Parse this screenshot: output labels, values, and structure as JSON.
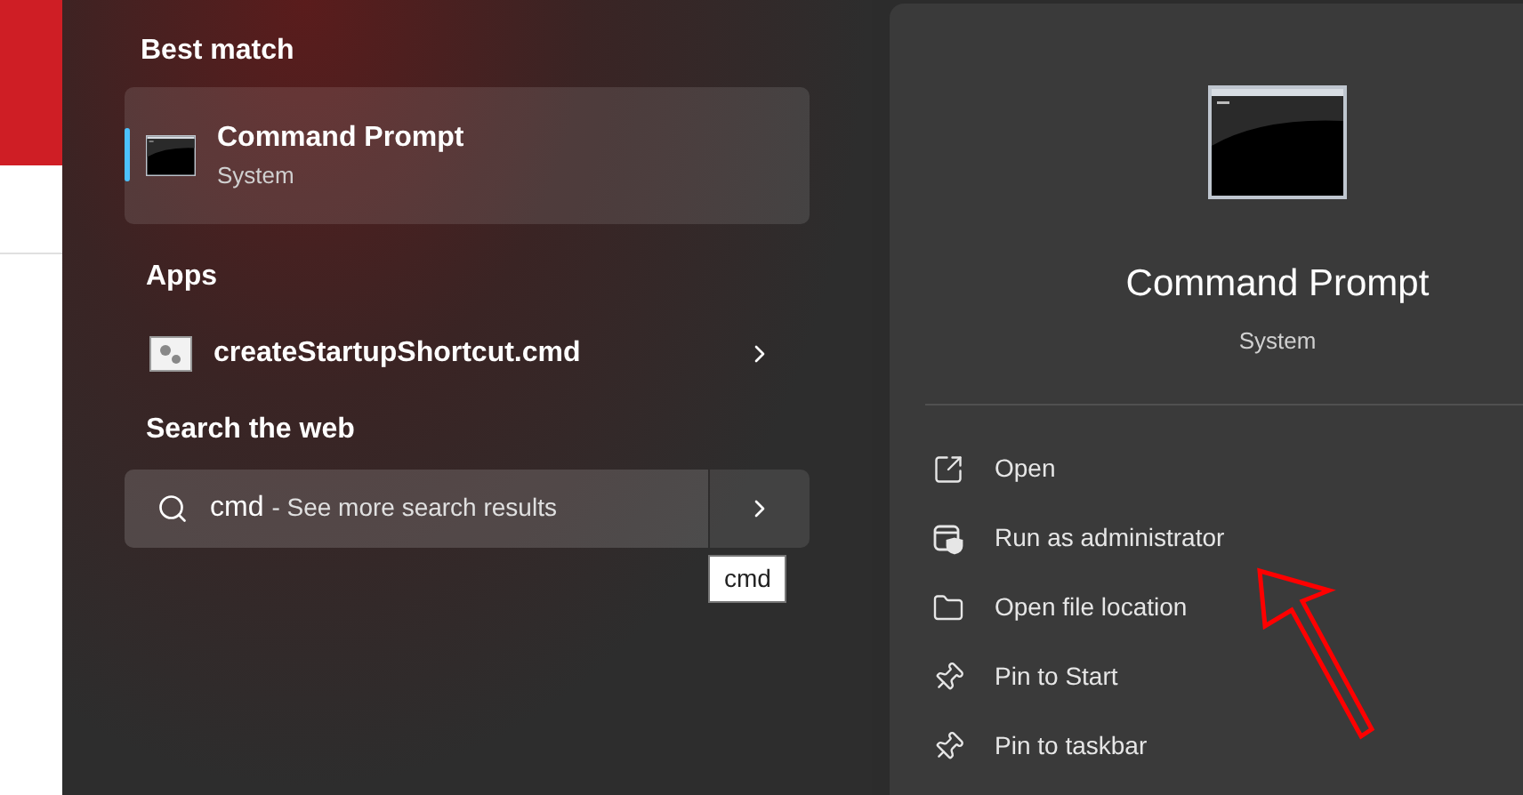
{
  "best_match": {
    "heading": "Best match",
    "item": {
      "title": "Command Prompt",
      "subtitle": "System",
      "selected": true
    }
  },
  "apps": {
    "heading": "Apps",
    "items": [
      {
        "label": "createStartupShortcut.cmd"
      }
    ]
  },
  "web": {
    "heading": "Search the web",
    "query": "cmd",
    "suffix": "- See more search results",
    "tooltip": "cmd"
  },
  "details": {
    "title": "Command Prompt",
    "subtitle": "System",
    "actions": [
      {
        "label": "Open",
        "kind": "open"
      },
      {
        "label": "Run as administrator",
        "kind": "admin"
      },
      {
        "label": "Open file location",
        "kind": "folder"
      },
      {
        "label": "Pin to Start",
        "kind": "pin"
      },
      {
        "label": "Pin to taskbar",
        "kind": "pin"
      }
    ]
  }
}
